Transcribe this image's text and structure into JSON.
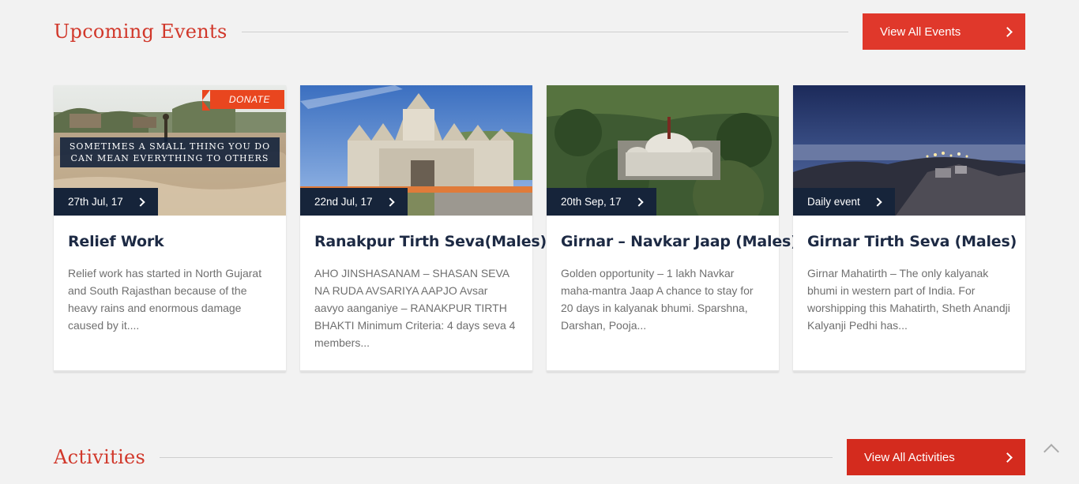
{
  "events_section": {
    "title": "Upcoming Events",
    "button_label": "View All Events"
  },
  "events": [
    {
      "date": "27th Jul, 17",
      "title": "Relief Work",
      "description": "Relief work has started in North Gujarat and South Rajasthan because of the heavy rains and enormous damage caused by it....",
      "ribbon": "DONATE",
      "overlay_text": "SOMETIMES A SMALL THING YOU DO CAN MEAN EVERYTHING TO OTHERS"
    },
    {
      "date": "22nd Jul, 17",
      "title": "Ranakpur Tirth Seva(Males)",
      "description": "AHO JINSHASANAM – SHASAN SEVA NA RUDA AVSARIYA AAPJO Avsar aavyo aanganiye –  RANAKPUR TIRTH BHAKTI  Minimum Criteria: 4 days seva 4 members..."
    },
    {
      "date": "20th Sep, 17",
      "title": "Girnar – Navkar Jaap (Males)",
      "description": "Golden opportunity – 1 lakh Navkar maha-mantra Jaap A chance to stay for 20 days in kalyanak bhumi. Sparshna, Darshan, Pooja..."
    },
    {
      "date": "Daily event",
      "title": "Girnar Tirth Seva (Males)",
      "description": "Girnar Mahatirth – The only kalyanak bhumi in western part of India. For worshipping this Mahatirth, Sheth Anandji Kalyanji Pedhi has..."
    }
  ],
  "activities_section": {
    "title": "Activities",
    "button_label": "View All Activities"
  },
  "colors": {
    "accent_red": "#e0382b",
    "title_red": "#d1382b",
    "navy": "#16243a",
    "background": "#f2f2f2"
  },
  "icons": {
    "button_arrow": "chevron-right-icon",
    "scroll_top": "chevron-up-icon"
  }
}
